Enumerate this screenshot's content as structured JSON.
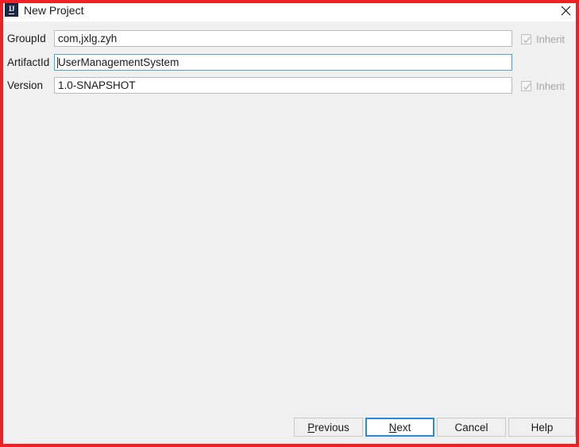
{
  "window": {
    "title": "New Project",
    "app_icon": "intellij-idea-icon",
    "icon_letters": "IJ",
    "close_icon": "close-icon",
    "background_color": "#f0f0f0",
    "titlebar_color": "#ffffff"
  },
  "annotation": {
    "highlight_color": "#ee2222"
  },
  "form": {
    "rows": [
      {
        "label": "GroupId",
        "value": "com,jxlg.zyh",
        "placeholder": "",
        "focused": false,
        "inherit": {
          "label": "Inherit",
          "checked": true,
          "enabled": false,
          "visible": true
        }
      },
      {
        "label": "ArtifactId",
        "value": "UserManagementSystem",
        "placeholder": "",
        "focused": true,
        "inherit": {
          "label": "",
          "checked": false,
          "enabled": false,
          "visible": false
        }
      },
      {
        "label": "Version",
        "value": "1.0-SNAPSHOT",
        "placeholder": "",
        "focused": false,
        "inherit": {
          "label": "Inherit",
          "checked": true,
          "enabled": false,
          "visible": true
        }
      }
    ]
  },
  "buttons": [
    {
      "name": "previous-button",
      "label": "Previous",
      "mnemonic": "P",
      "default": false
    },
    {
      "name": "next-button",
      "label": "Next",
      "mnemonic": "N",
      "default": true
    },
    {
      "name": "cancel-button",
      "label": "Cancel",
      "mnemonic": "",
      "default": false
    },
    {
      "name": "help-button",
      "label": "Help",
      "mnemonic": "",
      "default": false
    }
  ],
  "colors": {
    "focus_border": "#5a9ec9",
    "default_button_border": "#2a8ad4",
    "input_border": "#bcbcbc",
    "disabled_text": "#a6a6a6"
  }
}
